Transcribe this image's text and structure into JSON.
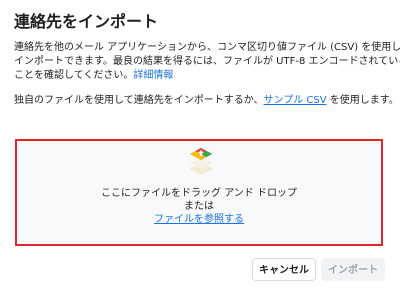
{
  "dialog": {
    "title": "連絡先をインポート",
    "description_line1": "連絡先を他のメール アプリケーションから、コンマ区切り値ファイル (CSV) を使用して",
    "description_line2": "インポートできます。最良の結果を得るには、ファイルが UTF-8 エンコードされている",
    "description_line3_prefix": "ことを確認してください。",
    "details_link": "詳細情報",
    "secondary_prefix": "独自のファイルを使用して連絡先をインポートするか、",
    "sample_csv_link": "サンプル CSV",
    "secondary_suffix": " を使用します。"
  },
  "dropzone": {
    "icon": "layers-upload-icon",
    "main_text": "ここにファイルをドラッグ アンド ドロップ",
    "or_text": "または",
    "browse_link": "ファイルを参照する",
    "border_color": "#e0262c"
  },
  "buttons": {
    "cancel": "キャンセル",
    "import": "インポート"
  },
  "colors": {
    "link": "#1a73e8",
    "text": "#1f1f1f",
    "disabled_text": "#a0a4a8"
  }
}
